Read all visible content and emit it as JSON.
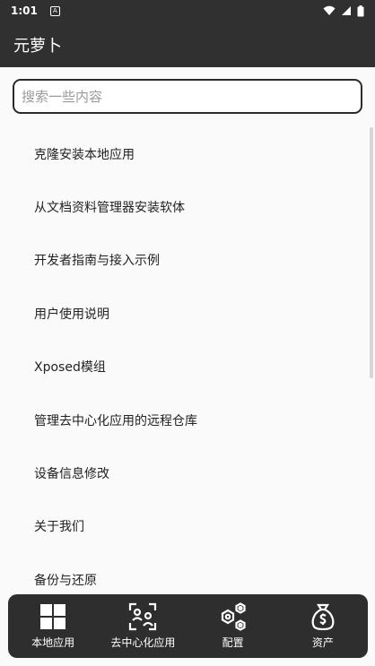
{
  "status_bar": {
    "time": "1:01",
    "notification_glyph": "A",
    "icons": [
      "wifi-icon",
      "signal-icon",
      "battery-icon"
    ]
  },
  "app_bar": {
    "title": "元萝卜"
  },
  "search": {
    "placeholder": "搜索一些内容",
    "value": ""
  },
  "menu": {
    "items": [
      {
        "label": "克隆安装本地应用"
      },
      {
        "label": "从文档资料管理器安装软体"
      },
      {
        "label": "开发者指南与接入示例"
      },
      {
        "label": "用户使用说明"
      },
      {
        "label": "Xposed模组"
      },
      {
        "label": "管理去中心化应用的远程仓库"
      },
      {
        "label": "设备信息修改"
      },
      {
        "label": "关于我们"
      },
      {
        "label": "备份与还原"
      }
    ]
  },
  "bottom_nav": {
    "items": [
      {
        "label": "本地应用",
        "icon": "grid-icon"
      },
      {
        "label": "去中心化应用",
        "icon": "decentralized-icon"
      },
      {
        "label": "配置",
        "icon": "hexagon-config-icon"
      },
      {
        "label": "资产",
        "icon": "money-bag-icon"
      }
    ]
  },
  "colors": {
    "bar_background": "#303030",
    "page_background": "#fafafa",
    "nav_background": "#2e2e2e",
    "text": "#222222"
  }
}
